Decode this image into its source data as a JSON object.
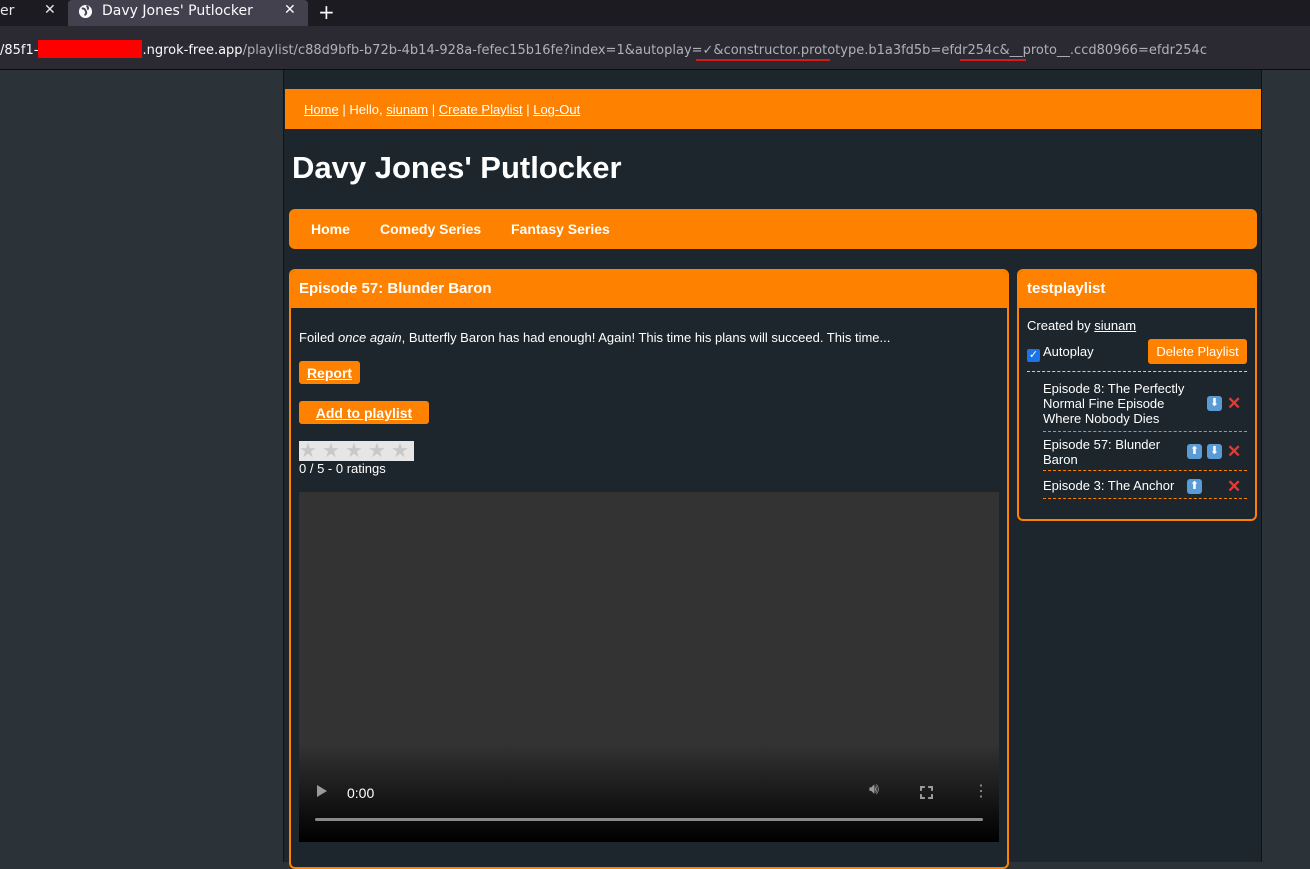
{
  "browser": {
    "prev_tab_title": "er",
    "tab_title": "Davy Jones' Putlocker",
    "new_tab": "+",
    "close": "✕",
    "url_prefix": "/85f1-",
    "url_host": ".ngrok-free.app",
    "url_path": "/playlist/c88d9bfb-b72b-4b14-928a-fefec15b16fe?index=1&autoplay=✓&constructor.prototype.b1a3fd5b=efdr254c&__proto__.ccd80966=efdr254c"
  },
  "topbar": {
    "home": "Home",
    "hello": "Hello,",
    "user": "siunam",
    "create_playlist": "Create Playlist",
    "logout": "Log-Out",
    "sep": "|"
  },
  "site": {
    "title": "Davy Jones' Putlocker"
  },
  "nav": {
    "items": [
      "Home",
      "Comedy Series",
      "Fantasy Series"
    ]
  },
  "episode": {
    "title": "Episode 57: Blunder Baron",
    "desc_before": "Foiled ",
    "desc_em": "once again",
    "desc_after": ", Butterfly Baron has had enough! Again! This time his plans will succeed. This time...",
    "report": "Report",
    "add_to_playlist": "Add to playlist",
    "rating_value": 0,
    "rating_text": "0 / 5 - 0 ratings",
    "video_time": "0:00"
  },
  "playlist": {
    "name": "testplaylist",
    "created_by": "Created by",
    "owner": "siunam",
    "autoplay_label": "Autoplay",
    "autoplay_checked": true,
    "delete": "Delete Playlist",
    "items": [
      {
        "title": "Episode 8: The Perfectly Normal Fine Episode Where Nobody Dies"
      },
      {
        "title": "Episode 57: Blunder Baron"
      },
      {
        "title": "Episode 3: The Anchor"
      }
    ]
  },
  "colors": {
    "accent": "#ff8100",
    "bg": "#1d262c",
    "delete": "#e53935"
  }
}
